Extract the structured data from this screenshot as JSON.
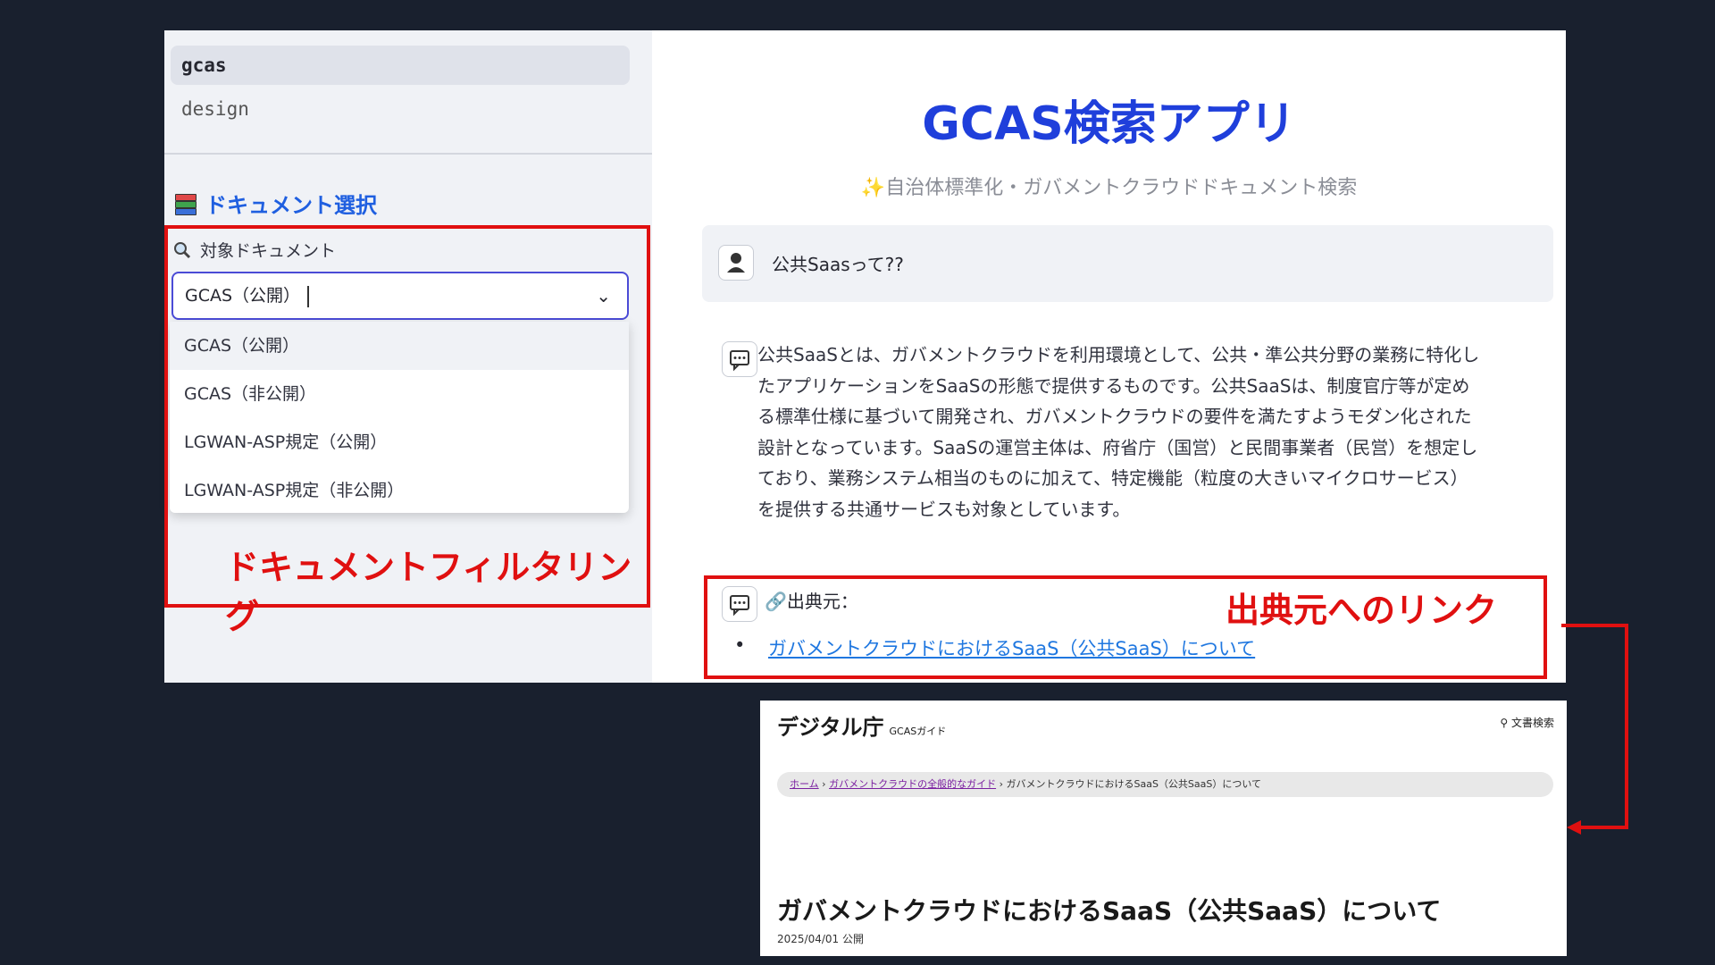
{
  "sidebar": {
    "nav_items": [
      "gcas",
      "design"
    ],
    "section_title": "ドキュメント選択",
    "filter_label": "対象ドキュメント",
    "select_value": "GCAS（公開）",
    "options": [
      "GCAS（公開）",
      "GCAS（非公開）",
      "LGWAN-ASP規定（公開）",
      "LGWAN-ASP規定（非公開）"
    ]
  },
  "main": {
    "title": "GCAS検索アプリ",
    "subtitle": "✨自治体標準化・ガバメントクラウドドキュメント検索",
    "user_message": "公共Saasって??",
    "answer_lines": [
      "公共SaaSとは、ガバメントクラウドを利用環境として、公共・準公共分野の業務に特化し",
      "たアプリケーションをSaaSの形態で提供するものです。公共SaaSは、制度官庁等が定め",
      "る標準仕様に基づいて開発され、ガバメントクラウドの要件を満たすようモダン化された",
      "設計となっています。SaaSの運営主体は、府省庁（国営）と民間事業者（民営）を想定し",
      "ており、業務システム相当のものに加えて、特定機能（粒度の大きいマイクロサービス）",
      "を提供する共通サービスも対象としています。"
    ],
    "source_label": "🔗出典元：",
    "source_link": "ガバメントクラウドにおけるSaaS（公共SaaS）について"
  },
  "annotations": {
    "filter": "ドキュメントフィルタリング",
    "source": "出典元へのリンク"
  },
  "preview": {
    "brand": "デジタル庁",
    "brand_sub": "GCASガイド",
    "search": "文書検索",
    "crumb_home": "ホーム",
    "crumb_mid": "ガバメントクラウドの全般的なガイド",
    "crumb_current": "ガバメントクラウドにおけるSaaS（公共SaaS）について",
    "title": "ガバメントクラウドにおけるSaaS（公共SaaS）について",
    "date": "2025/04/01 公開"
  },
  "colors": {
    "accent": "#1f3fdb",
    "annotation": "#e01010",
    "background": "#19202e"
  }
}
